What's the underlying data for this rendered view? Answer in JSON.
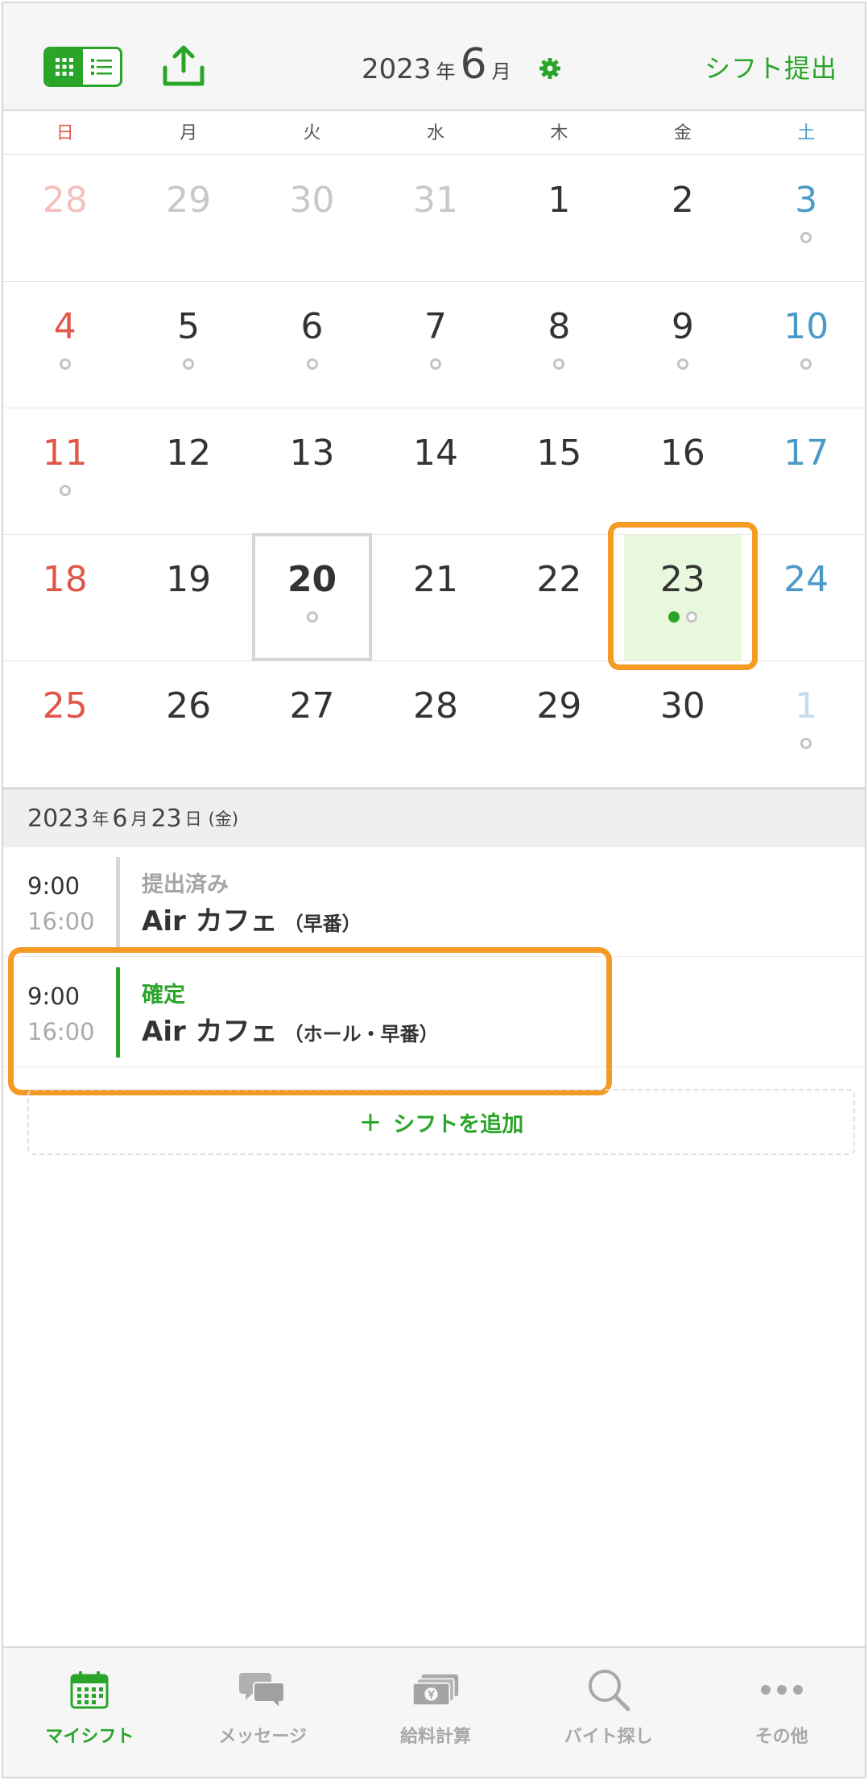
{
  "header": {
    "year": "2023",
    "year_suffix": "年",
    "month": "6",
    "month_suffix": "月",
    "submit_label": "シフト提出"
  },
  "colors": {
    "accent": "#2aa52a",
    "highlight": "#f59a23",
    "sunday": "#e0574a",
    "saturday": "#4a9ac8"
  },
  "weekdays": [
    "日",
    "月",
    "火",
    "水",
    "木",
    "金",
    "土"
  ],
  "calendar": {
    "weeks": [
      [
        {
          "day": "28",
          "other": true,
          "dots": 0
        },
        {
          "day": "29",
          "other": true,
          "dots": 0
        },
        {
          "day": "30",
          "other": true,
          "dots": 0
        },
        {
          "day": "31",
          "other": true,
          "dots": 0
        },
        {
          "day": "1",
          "dots": 0
        },
        {
          "day": "2",
          "dots": 0
        },
        {
          "day": "3",
          "dots": 1
        }
      ],
      [
        {
          "day": "4",
          "dots": 1
        },
        {
          "day": "5",
          "dots": 1
        },
        {
          "day": "6",
          "dots": 1
        },
        {
          "day": "7",
          "dots": 1
        },
        {
          "day": "8",
          "dots": 1
        },
        {
          "day": "9",
          "dots": 1
        },
        {
          "day": "10",
          "dots": 1
        }
      ],
      [
        {
          "day": "11",
          "dots": 1
        },
        {
          "day": "12",
          "dots": 0
        },
        {
          "day": "13",
          "dots": 0
        },
        {
          "day": "14",
          "dots": 0
        },
        {
          "day": "15",
          "dots": 0
        },
        {
          "day": "16",
          "dots": 0
        },
        {
          "day": "17",
          "dots": 0
        }
      ],
      [
        {
          "day": "18",
          "dots": 0
        },
        {
          "day": "19",
          "dots": 0
        },
        {
          "day": "20",
          "dots": 1,
          "today": true
        },
        {
          "day": "21",
          "dots": 0
        },
        {
          "day": "22",
          "dots": 0
        },
        {
          "day": "23",
          "dots": 1,
          "confirmed": true,
          "selected": true
        },
        {
          "day": "24",
          "dots": 0
        }
      ],
      [
        {
          "day": "25",
          "dots": 0
        },
        {
          "day": "26",
          "dots": 0
        },
        {
          "day": "27",
          "dots": 0
        },
        {
          "day": "28",
          "dots": 0
        },
        {
          "day": "29",
          "dots": 0
        },
        {
          "day": "30",
          "dots": 0
        },
        {
          "day": "1",
          "other": true,
          "dots": 1
        }
      ]
    ]
  },
  "selected_date": {
    "year": "2023",
    "year_suffix": "年",
    "month": "6",
    "month_suffix": "月",
    "day": "23",
    "day_suffix": "日",
    "weekday": "(金)"
  },
  "shifts": [
    {
      "start": "9:00",
      "end": "16:00",
      "status": "提出済み",
      "place": "Air カフェ",
      "detail": "（早番）"
    },
    {
      "start": "9:00",
      "end": "16:00",
      "status": "確定",
      "place": "Air カフェ",
      "detail": "（ホール・早番）"
    }
  ],
  "add_shift": {
    "plus": "+",
    "label": "シフトを追加"
  },
  "tabs": [
    {
      "label": "マイシフト",
      "icon": "calendar-icon"
    },
    {
      "label": "メッセージ",
      "icon": "chat-icon"
    },
    {
      "label": "給料計算",
      "icon": "money-icon"
    },
    {
      "label": "バイト探し",
      "icon": "search-icon"
    },
    {
      "label": "その他",
      "icon": "more-icon"
    }
  ]
}
